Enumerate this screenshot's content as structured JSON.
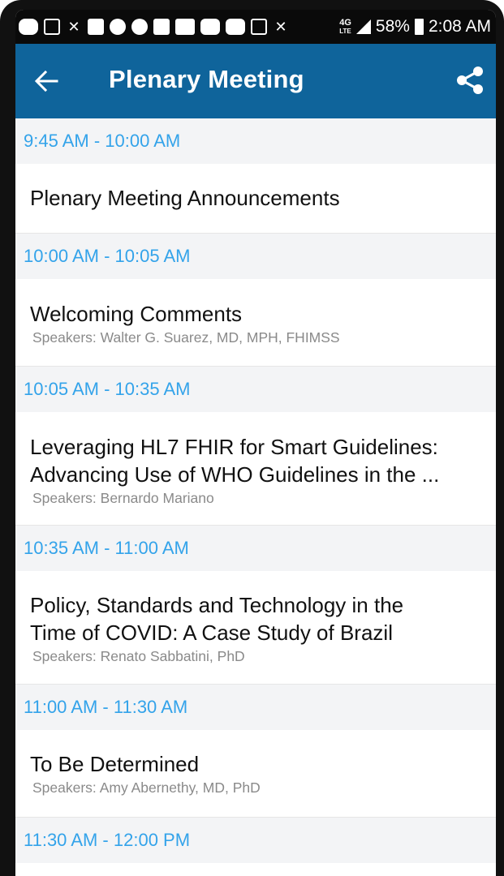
{
  "status_bar": {
    "network": "4G",
    "network_sub": "LTE",
    "battery": "58%",
    "time": "2:08 AM"
  },
  "app_bar": {
    "back_icon": "arrow-left-icon",
    "title": "Plenary Meeting",
    "share_icon": "share-icon"
  },
  "colors": {
    "app_bar": "#0f649b",
    "time_header_text": "#33a3ea",
    "time_header_bg": "#f3f4f6"
  },
  "agenda": [
    {
      "time": "9:45 AM - 10:00 AM",
      "title": "Plenary Meeting Announcements",
      "speakers": ""
    },
    {
      "time": "10:00 AM - 10:05 AM",
      "title": "Welcoming Comments",
      "speakers": "Speakers: Walter G. Suarez, MD, MPH, FHIMSS"
    },
    {
      "time": "10:05 AM - 10:35 AM",
      "title_line1": "Leveraging HL7 FHIR for Smart Guidelines:",
      "title_line2": "Advancing Use of WHO Guidelines in the ...",
      "speakers": "Speakers: Bernardo Mariano"
    },
    {
      "time": "10:35 AM - 11:00 AM",
      "title_line1": "Policy, Standards and Technology in the",
      "title_line2": "Time of COVID: A Case Study of Brazil",
      "speakers": "Speakers: Renato Sabbatini, PhD"
    },
    {
      "time": "11:00 AM - 11:30 AM",
      "title": "To Be Determined",
      "speakers": "Speakers: Amy Abernethy, MD, PhD"
    },
    {
      "time": "11:30 AM - 12:00 PM"
    }
  ]
}
